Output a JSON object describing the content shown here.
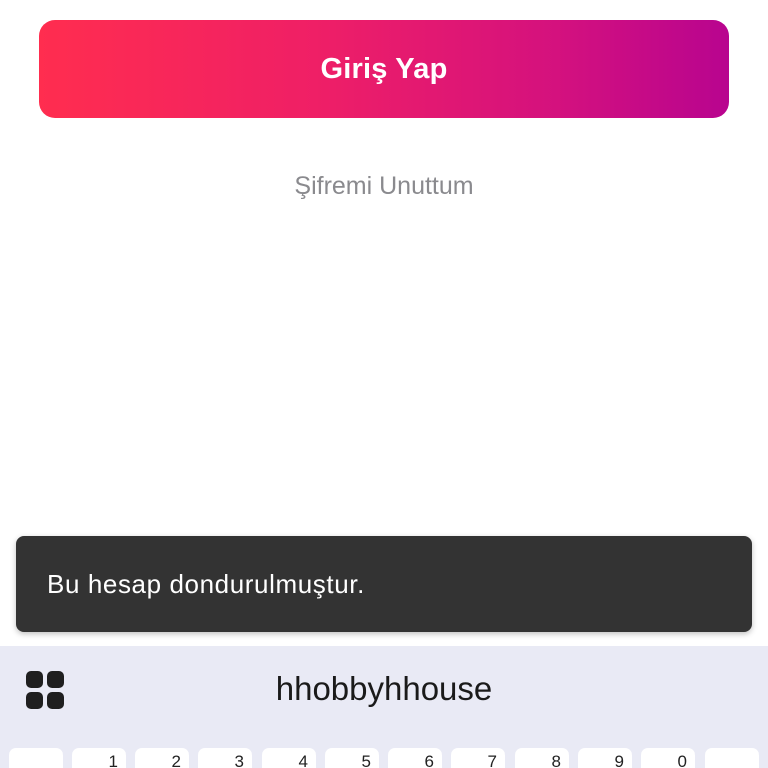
{
  "login": {
    "button_label": "Giriş Yap",
    "forgot_password_label": "Şifremi Unuttum"
  },
  "toast": {
    "message": "Bu hesap dondurulmuştur."
  },
  "keyboard": {
    "apps_icon": "grid-icon",
    "suggestion": "hhobbyhhouse",
    "number_hints": [
      "",
      "1",
      "2",
      "3",
      "4",
      "5",
      "6",
      "7",
      "8",
      "9",
      "0",
      ""
    ]
  },
  "colors": {
    "gradient_start": "#ff2d4f",
    "gradient_end": "#b8048f",
    "toast_bg": "#333333",
    "keyboard_bg": "#e9eaf5",
    "link_gray": "#8a8a8e"
  }
}
